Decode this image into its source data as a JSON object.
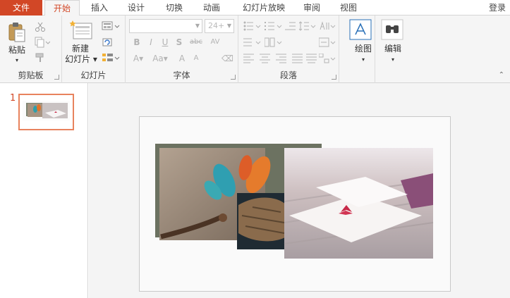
{
  "tabs": {
    "file": "文件",
    "items": [
      "开始",
      "插入",
      "设计",
      "切换",
      "动画",
      "幻灯片放映",
      "审阅",
      "视图"
    ],
    "active": "开始",
    "login": "登录"
  },
  "ribbon": {
    "clipboard": {
      "paste": "粘贴",
      "label": "剪贴板"
    },
    "slides": {
      "new_slide_line1": "新建",
      "new_slide_line2": "幻灯片",
      "label": "幻灯片"
    },
    "font": {
      "font_name": "",
      "font_size": "24+",
      "label": "字体"
    },
    "paragraph": {
      "label": "段落"
    },
    "drawing": {
      "label": "绘图"
    },
    "editing": {
      "label": "编辑"
    }
  },
  "slides_panel": {
    "slide_number": "1"
  },
  "colors": {
    "accent": "#d24726",
    "thumb_border": "#e8835e",
    "ribbon_bg": "#f5f5f5",
    "canvas_bg": "#f4f4f4"
  },
  "icons": [
    "paste-icon",
    "cut-icon",
    "copy-icon",
    "format-painter-icon",
    "new-slide-icon",
    "layout-icon",
    "reset-icon",
    "section-icon",
    "bold-icon",
    "italic-icon",
    "underline-icon",
    "shadow-icon",
    "strikethrough-icon",
    "char-spacing-icon",
    "clear-format-icon",
    "bullets-icon",
    "numbering-icon",
    "align-left-icon",
    "align-center-icon",
    "align-right-icon",
    "justify-icon",
    "line-spacing-icon",
    "text-direction-icon",
    "drawing-icon",
    "binoculars-icon"
  ]
}
